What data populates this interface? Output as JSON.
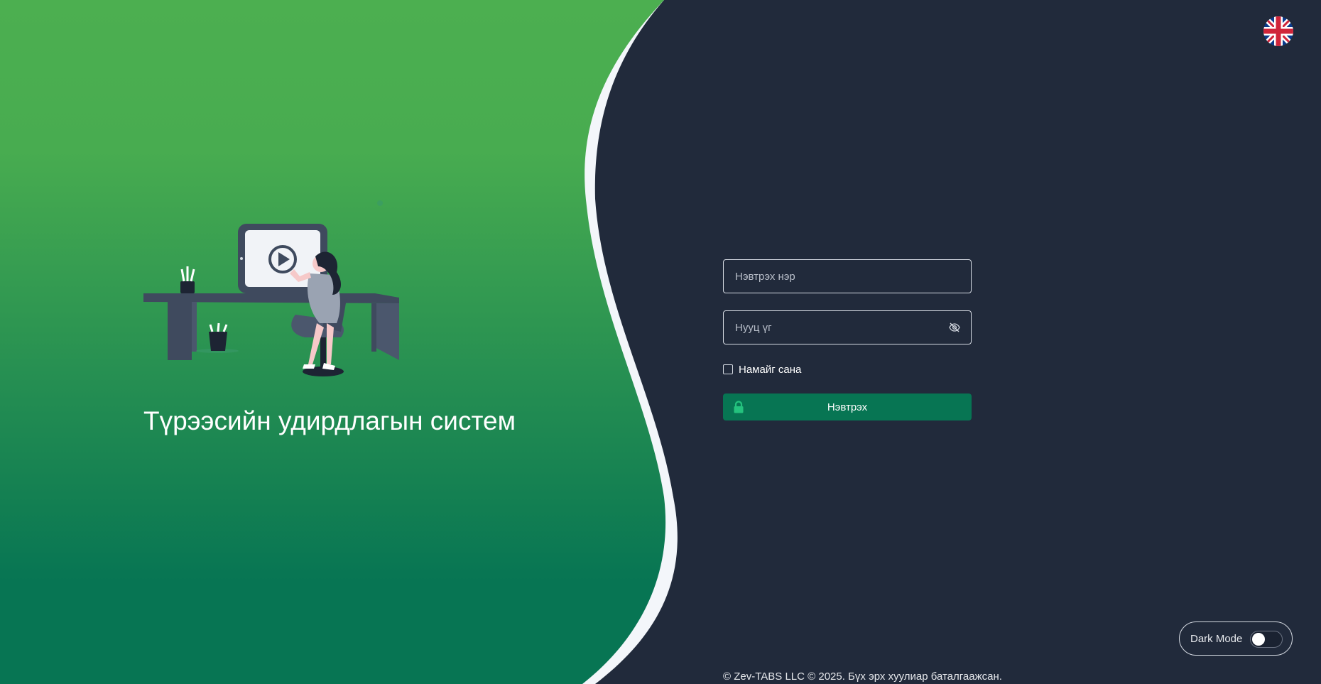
{
  "app": {
    "system_title": "Түрээсийн удирдлагын систем"
  },
  "language": {
    "icon": "uk-flag-icon"
  },
  "login_form": {
    "username_placeholder": "Нэвтрэх нэр",
    "password_placeholder": "Нууц үг",
    "remember_label": "Намайг сана",
    "remember_checked": false,
    "login_button_label": "Нэвтрэх",
    "login_icon": "lock-icon",
    "eye_icon": "eye-slash-icon"
  },
  "dark_mode": {
    "label": "Dark Mode",
    "enabled": false
  },
  "footer": {
    "copyright": "© Zev-TABS LLC © 2025. Бүх эрх хуулиар баталгаажсан."
  },
  "colors": {
    "green_top": "#4caf50",
    "green_bottom": "#077553",
    "dark_bg": "#212a3b",
    "button": "#077553",
    "accent_curve": "#f3f6fa"
  }
}
